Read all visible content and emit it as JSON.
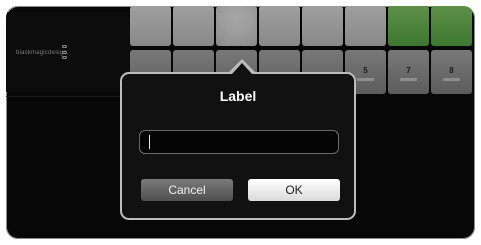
{
  "brand": {
    "text": "blackmagicdesign",
    "logo": "blackmagic-logo-icon"
  },
  "buttons": {
    "top_row": [
      {
        "state": "white"
      },
      {
        "state": "white"
      },
      {
        "state": "lit"
      },
      {
        "state": "white"
      },
      {
        "state": "white"
      },
      {
        "state": "white"
      },
      {
        "state": "green"
      },
      {
        "state": "green"
      }
    ],
    "bottom_row": [
      {
        "label": ""
      },
      {
        "label": ""
      },
      {
        "label": ""
      },
      {
        "label": ""
      },
      {
        "label": ""
      },
      {
        "label": "5"
      },
      {
        "label": "7"
      },
      {
        "label": "8"
      }
    ]
  },
  "dialog": {
    "title": "Label",
    "input": {
      "value": "",
      "placeholder": ""
    },
    "cancel_label": "Cancel",
    "ok_label": "OK"
  },
  "colors": {
    "dialog_bg": "#111111",
    "dialog_border": "#bcbcbc",
    "green": "#6dc655"
  }
}
